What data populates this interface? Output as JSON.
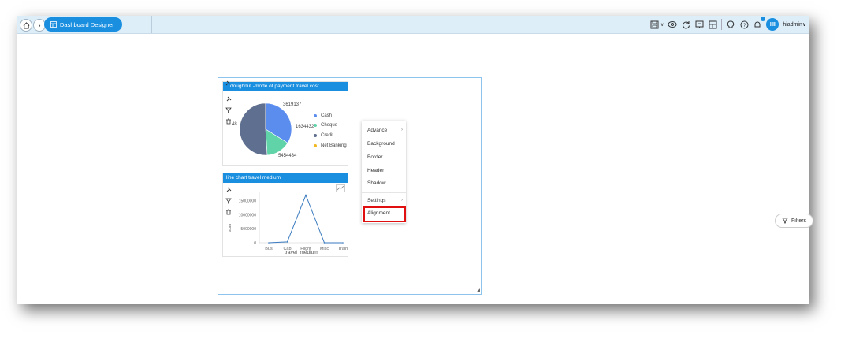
{
  "header": {
    "crumb_label": "Dashboard Designer",
    "user_initials": "HI",
    "user_name": "hiadmin"
  },
  "toolbar": {
    "icons": [
      "save-icon",
      "view-icon",
      "refresh-icon",
      "present-icon",
      "layout-icon",
      "bulb-icon",
      "help-icon",
      "notification-icon"
    ]
  },
  "pie_widget": {
    "title": "doughnut -mode of payment travel cost",
    "labels": [
      "3619137",
      "1634432",
      "5454434",
      "48"
    ],
    "legend": [
      {
        "name": "Cash",
        "color": "#5b8def"
      },
      {
        "name": "Cheque",
        "color": "#60d3a8"
      },
      {
        "name": "Credit",
        "color": "#5f6f8f"
      },
      {
        "name": "Net Banking",
        "color": "#f2b822"
      }
    ]
  },
  "line_widget": {
    "title": "line chart travel medium",
    "xlabel": "travel_medium",
    "ylabel": "sum"
  },
  "chart_data": [
    {
      "type": "pie",
      "title": "doughnut -mode of payment travel cost",
      "categories": [
        "Cash",
        "Cheque",
        "Credit",
        "Net Banking"
      ],
      "values": [
        3619137,
        1634432,
        5454434,
        48
      ],
      "colors": [
        "#5b8def",
        "#60d3a8",
        "#5f6f8f",
        "#f2b822"
      ]
    },
    {
      "type": "line",
      "title": "line chart travel medium",
      "categories": [
        "Bus",
        "Cab",
        "Flight",
        "Misc",
        "Train"
      ],
      "values": [
        0,
        300000,
        17000000,
        0,
        0
      ],
      "xlabel": "travel_medium",
      "ylabel": "sum",
      "yticks": [
        "15000000",
        "10000000",
        "5000000",
        "0"
      ],
      "ylim": [
        0,
        18000000
      ],
      "color": "#3a7abf"
    }
  ],
  "context_menu": {
    "items": [
      {
        "label": "Advance",
        "submenu": true
      },
      {
        "label": "Background",
        "submenu": false
      },
      {
        "label": "Border",
        "submenu": false
      },
      {
        "label": "Header",
        "submenu": false
      },
      {
        "label": "Shadow",
        "submenu": false
      },
      {
        "label": "Settings",
        "submenu": true
      },
      {
        "label": "Alignment",
        "submenu": false,
        "highlighted": true
      }
    ]
  },
  "filters_label": "Filters"
}
